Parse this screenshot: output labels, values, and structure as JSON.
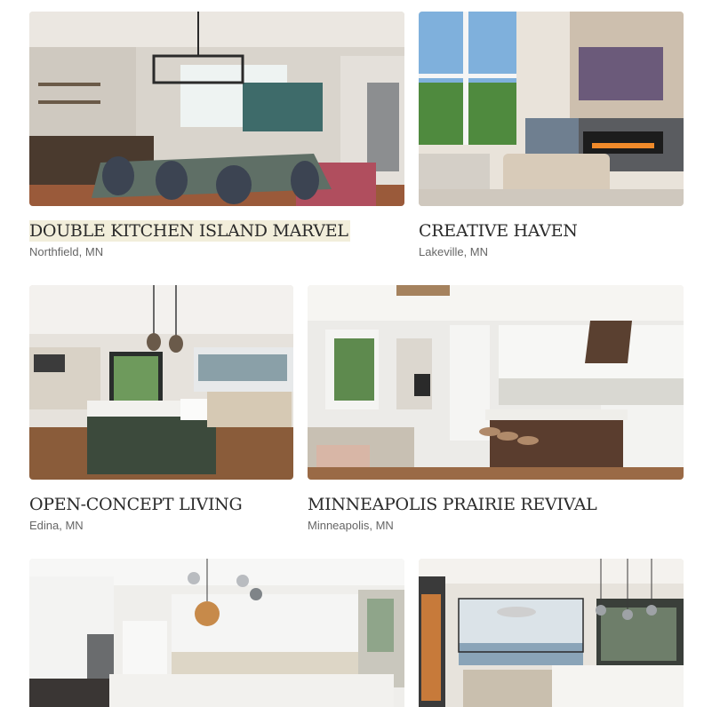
{
  "projects": [
    {
      "title": "DOUBLE KITCHEN ISLAND MARVEL",
      "location": "Northfield, MN",
      "image": "kitchen-island-photo"
    },
    {
      "title": "CREATIVE HAVEN",
      "location": "Lakeville, MN",
      "image": "living-room-fireplace-photo"
    },
    {
      "title": "OPEN-CONCEPT LIVING",
      "location": "Edina, MN",
      "image": "open-kitchen-green-island-photo"
    },
    {
      "title": "MINNEAPOLIS PRAIRIE REVIVAL",
      "location": "Minneapolis, MN",
      "image": "white-kitchen-wood-island-photo"
    },
    {
      "title": "",
      "location": "",
      "image": "white-kitchen-pendants-photo"
    },
    {
      "title": "",
      "location": "",
      "image": "lake-view-dining-photo"
    }
  ],
  "colors": {
    "title": "#2b2b2b",
    "location": "#666666",
    "highlight": "#f2eedb"
  }
}
